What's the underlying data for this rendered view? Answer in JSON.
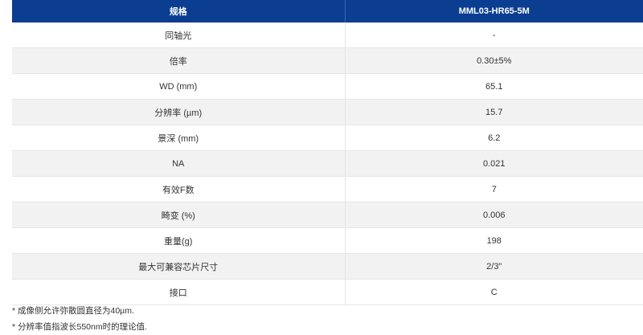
{
  "table": {
    "header": {
      "col1": "规格",
      "col2": "MML03-HR65-5M"
    },
    "rows": [
      {
        "label": "同轴光",
        "value": "-"
      },
      {
        "label": "倍率",
        "value": "0.30±5%"
      },
      {
        "label": "WD (mm)",
        "value": "65.1"
      },
      {
        "label": "分辨率 (µm)",
        "value": "15.7"
      },
      {
        "label": "景深 (mm)",
        "value": "6.2"
      },
      {
        "label": "NA",
        "value": "0.021"
      },
      {
        "label": "有效F数",
        "value": "7"
      },
      {
        "label": "畸变 (%)",
        "value": "0.006"
      },
      {
        "label": "重量(g)",
        "value": "198"
      },
      {
        "label": "最大可兼容芯片尺寸",
        "value": "2/3\""
      },
      {
        "label": "接口",
        "value": "C"
      }
    ]
  },
  "notes": [
    "* 成像侧允许弥散圆直径为40µm.",
    "* 分辨率值指波长550nm时的理论值."
  ]
}
